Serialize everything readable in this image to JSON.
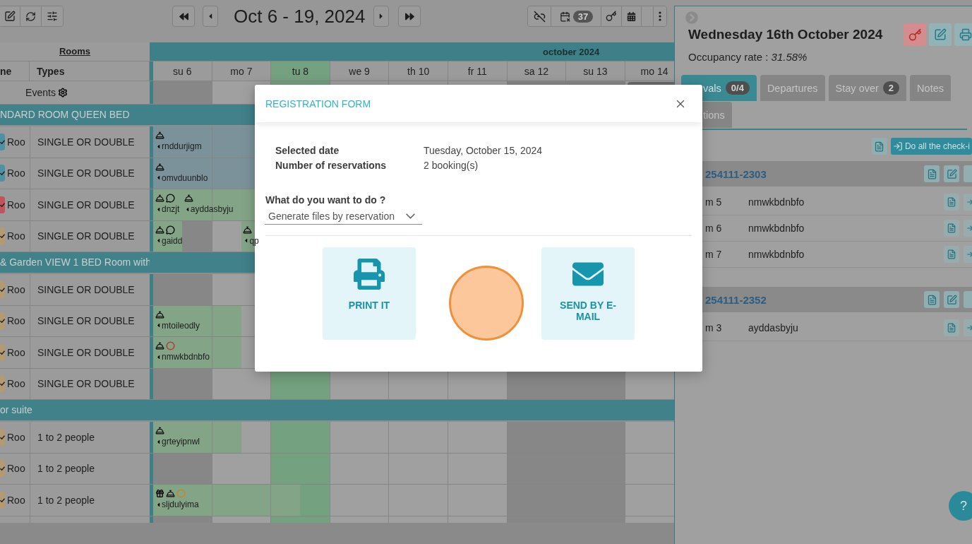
{
  "toolbar": {
    "title": "Oct 6 - 19, 2024",
    "badge": "37"
  },
  "grid": {
    "rooms_heading": "Rooms",
    "month": "october 2024",
    "columns": [
      "ne",
      "Types"
    ],
    "events_label": "Events",
    "days": [
      {
        "label": "su 6",
        "weekend": true,
        "selected": false
      },
      {
        "label": "mo 7",
        "weekend": false,
        "selected": false
      },
      {
        "label": "tu 8",
        "weekend": false,
        "selected": true
      },
      {
        "label": "we 9",
        "weekend": false,
        "selected": false
      },
      {
        "label": "th 10",
        "weekend": false,
        "selected": false
      },
      {
        "label": "fr 11",
        "weekend": false,
        "selected": false
      },
      {
        "label": "sa 12",
        "weekend": true,
        "selected": false
      },
      {
        "label": "su 13",
        "weekend": true,
        "selected": false
      },
      {
        "label": "mo 14",
        "weekend": false,
        "selected": false
      }
    ],
    "sections": [
      {
        "title": "NDARD ROOM QUEEN BED",
        "rooms": [
          {
            "name": "Roo",
            "type": "SINGLE OR DOUBLE",
            "color": "#4f90a3",
            "cells": [
              {
                "first": true,
                "second": true,
                "color": "#7c929b",
                "labels": [
                  {
                    "guest": "rnddurjigm",
                    "late": false,
                    "icons": [
                      {
                        "kind": "bell"
                      }
                    ]
                  }
                ]
              },
              {
                "first": true,
                "second": true,
                "color": "#7c929b"
              }
            ]
          },
          {
            "name": "Roo",
            "type": "SINGLE OR DOUBLE",
            "color": "#4f90a3",
            "cells": [
              {
                "first": true,
                "second": true,
                "color": "#7c929b",
                "labels": [
                  {
                    "guest": "omvduunblo",
                    "late": false,
                    "icons": [
                      {
                        "kind": "bell"
                      }
                    ]
                  }
                ]
              },
              {
                "first": true,
                "second": true,
                "color": "#7c929b"
              }
            ]
          },
          {
            "name": "Roo",
            "type": "SINGLE OR DOUBLE",
            "color": "#c0545c",
            "cells": [
              {
                "first": true,
                "second": true,
                "color": "#84a487",
                "labels": [
                  {
                    "guest": "dnzjt",
                    "late": false,
                    "icons": [
                      {
                        "kind": "bell"
                      },
                      {
                        "kind": "comment"
                      }
                    ]
                  },
                  {
                    "guest": "ayddasbyju",
                    "late": true,
                    "icons": [
                      {
                        "kind": "bell"
                      }
                    ]
                  }
                ]
              },
              {
                "first": true,
                "second": true,
                "color": "#84a487"
              }
            ]
          },
          {
            "name": "Roo",
            "type": "SINGLE OR DOUBLE",
            "color": "#b39a72",
            "cells": [
              {
                "first": true,
                "second": false,
                "color": "#84a487",
                "labels": [
                  {
                    "guest": "gaidd",
                    "late": false,
                    "icons": [
                      {
                        "kind": "bell"
                      },
                      {
                        "kind": "comment"
                      }
                    ]
                  }
                ]
              },
              {
                "first": false,
                "second": true,
                "color": "#84a487",
                "labels": [
                  {
                    "guest": "qp",
                    "late": true,
                    "icons": [
                      {
                        "kind": "bell"
                      }
                    ]
                  }
                ]
              }
            ]
          }
        ]
      },
      {
        "title": "& Garden VIEW 1 BED Room with",
        "rooms": [
          {
            "name": "Roo",
            "type": "SINGLE OR DOUBLE",
            "color": "#b39a72"
          },
          {
            "name": "Roo",
            "type": "SINGLE OR DOUBLE",
            "color": "#b39a72",
            "cells": [
              {
                "first": true,
                "second": true,
                "color": "#84a487",
                "labels": [
                  {
                    "guest": "mtoileodly",
                    "late": false,
                    "icons": [
                      {
                        "kind": "bell"
                      }
                    ]
                  }
                ]
              },
              {
                "first": true,
                "second": false,
                "color": "#84a487"
              }
            ]
          },
          {
            "name": "Roo",
            "type": "SINGLE OR DOUBLE",
            "color": "#b39a72",
            "cells": [
              {
                "first": true,
                "second": true,
                "color": "#84a487",
                "labels": [
                  {
                    "guest": "nmwkbdnbfo",
                    "late": false,
                    "icons": [
                      {
                        "kind": "bell"
                      },
                      {
                        "kind": "ring",
                        "color": "#b2403a"
                      }
                    ]
                  }
                ]
              },
              {
                "first": true,
                "second": false,
                "color": "#84a487"
              }
            ]
          },
          {
            "name": "Roo",
            "type": "SINGLE OR DOUBLE",
            "color": "#b39a72"
          }
        ]
      },
      {
        "title": "or suite",
        "rooms": [
          {
            "name": "Roo",
            "type": "1 to 2 people",
            "color": "#b39a72",
            "cells": [
              {
                "first": true,
                "second": true,
                "color": "#84a487",
                "labels": [
                  {
                    "guest": "grteyipnwl",
                    "late": false,
                    "icons": [
                      {
                        "kind": "bell"
                      }
                    ]
                  }
                ]
              },
              {
                "first": true,
                "second": false,
                "color": "#84a487"
              }
            ]
          },
          {
            "name": "Roo",
            "type": "1 to 2 people",
            "color": "#b39a72"
          },
          {
            "name": "Roo",
            "type": "1 to 2 people",
            "color": "#b39a72",
            "cells": [
              {
                "first": true,
                "second": true,
                "color": "#84a487",
                "labels": [
                  {
                    "guest": "sljdulyima",
                    "late": false,
                    "icons": [
                      {
                        "kind": "gift"
                      },
                      {
                        "kind": "bell"
                      },
                      {
                        "kind": "ring",
                        "color": "#c08a2c"
                      }
                    ]
                  }
                ]
              },
              {
                "first": true,
                "second": true,
                "color": "#84a487"
              },
              {
                "first": true,
                "second": false,
                "color": "#84a487"
              }
            ]
          }
        ]
      }
    ]
  },
  "day_panel": {
    "title": "Wednesday 16th October 2024",
    "occupancy": "Occupancy rate : *31.58%*",
    "tabs": [
      {
        "label": "vals",
        "badge": "0/4",
        "selected": true
      },
      {
        "label": "Departures",
        "selected": false
      },
      {
        "label": "Stay over",
        "badge": "2",
        "selected": false
      },
      {
        "label": "Notes",
        "selected": false
      },
      {
        "label": "tions",
        "selected": false
      }
    ],
    "bulk_action": "Do all the check-i",
    "reservations": [
      {
        "number": "254111-2303",
        "rooms": [
          {
            "room": "m 5",
            "guest": "nmwkbdnbfo"
          },
          {
            "room": "m 6",
            "guest": "nmwkbdnbfo"
          },
          {
            "room": "m 7",
            "guest": "nmwkbdnbfo"
          }
        ]
      },
      {
        "number": "254111-2352",
        "rooms": [
          {
            "room": "m 3",
            "guest": "ayddasbyju"
          }
        ]
      }
    ],
    "help": "?"
  },
  "dialog": {
    "title": "REGISTRATION FORM",
    "fields": [
      {
        "label": "Selected date",
        "value": "Tuesday, October 15, 2024"
      },
      {
        "label": "Number of reservations",
        "value": "2 booking(s)"
      }
    ],
    "question": "What do you want to do ?",
    "select": {
      "value": "Generate files by reservation"
    },
    "actions": [
      {
        "label": "PRINT IT",
        "kind": "print"
      },
      {
        "label": "SEND BY E-MAIL",
        "kind": "email"
      }
    ]
  }
}
